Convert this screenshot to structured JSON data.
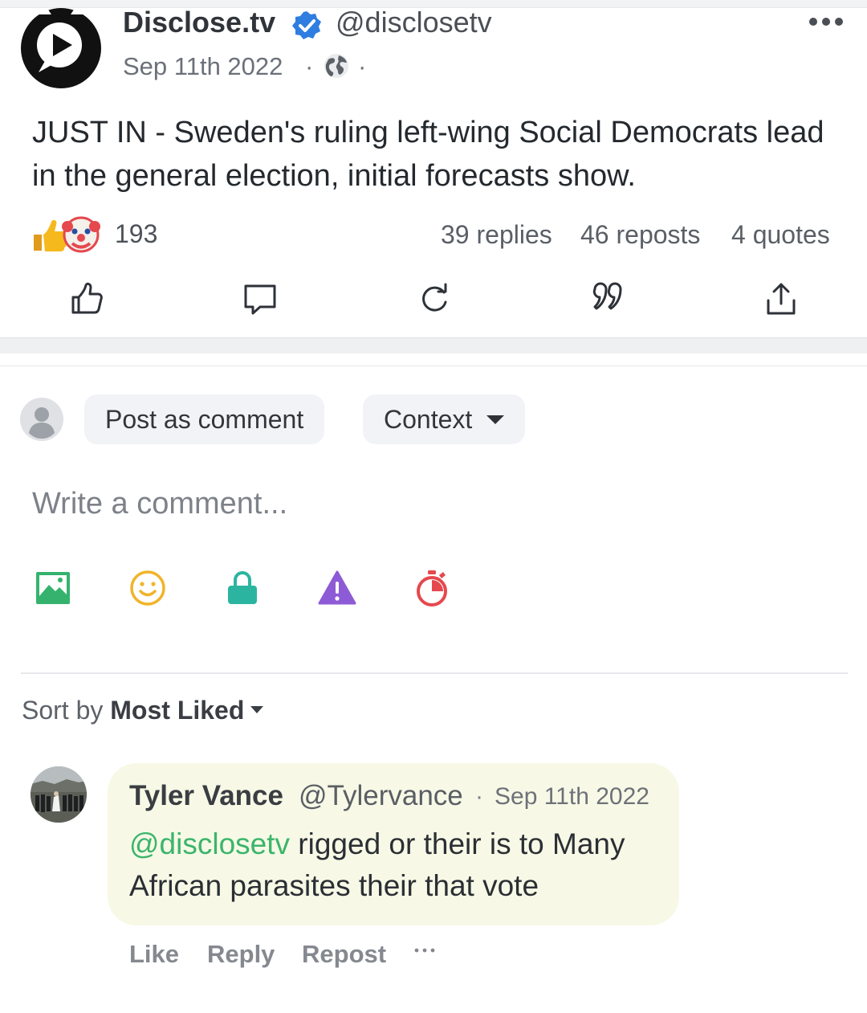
{
  "post": {
    "author_name": "Disclose.tv",
    "handle": "@disclosetv",
    "date": "Sep 11th 2022",
    "separator": "·",
    "text": "JUST IN - Sweden's ruling left-wing Social Democrats lead in the general election, initial forecasts show.",
    "reaction_count": "193",
    "reaction_icons": [
      "thumbs-up-emoji",
      "clown-emoji"
    ],
    "stats": {
      "replies": "39 replies",
      "reposts": "46 reposts",
      "quotes": "4 quotes"
    },
    "actions": [
      "like-icon",
      "comment-icon",
      "repost-icon",
      "quote-icon",
      "share-icon"
    ]
  },
  "composer": {
    "post_as_label": "Post as comment",
    "context_label": "Context",
    "placeholder": "Write a comment...",
    "tools": [
      "image-icon",
      "emoji-icon",
      "lock-icon",
      "warning-icon",
      "timer-icon"
    ],
    "colors": {
      "image": "#35b36e",
      "emoji": "#f0b429",
      "lock": "#2bb5a0",
      "warning": "#8e5bd6",
      "timer": "#e5484d"
    }
  },
  "sort": {
    "prefix": "Sort by",
    "value": "Most Liked"
  },
  "comments": [
    {
      "name": "Tyler Vance",
      "handle": "@Tylervance",
      "separator": "·",
      "date": "Sep 11th 2022",
      "mention": "@disclosetv",
      "text": " rigged or their is to Many African parasites their that vote",
      "bubble_color": "#f7f9e6",
      "actions": {
        "like": "Like",
        "reply": "Reply",
        "repost": "Repost"
      }
    }
  ]
}
